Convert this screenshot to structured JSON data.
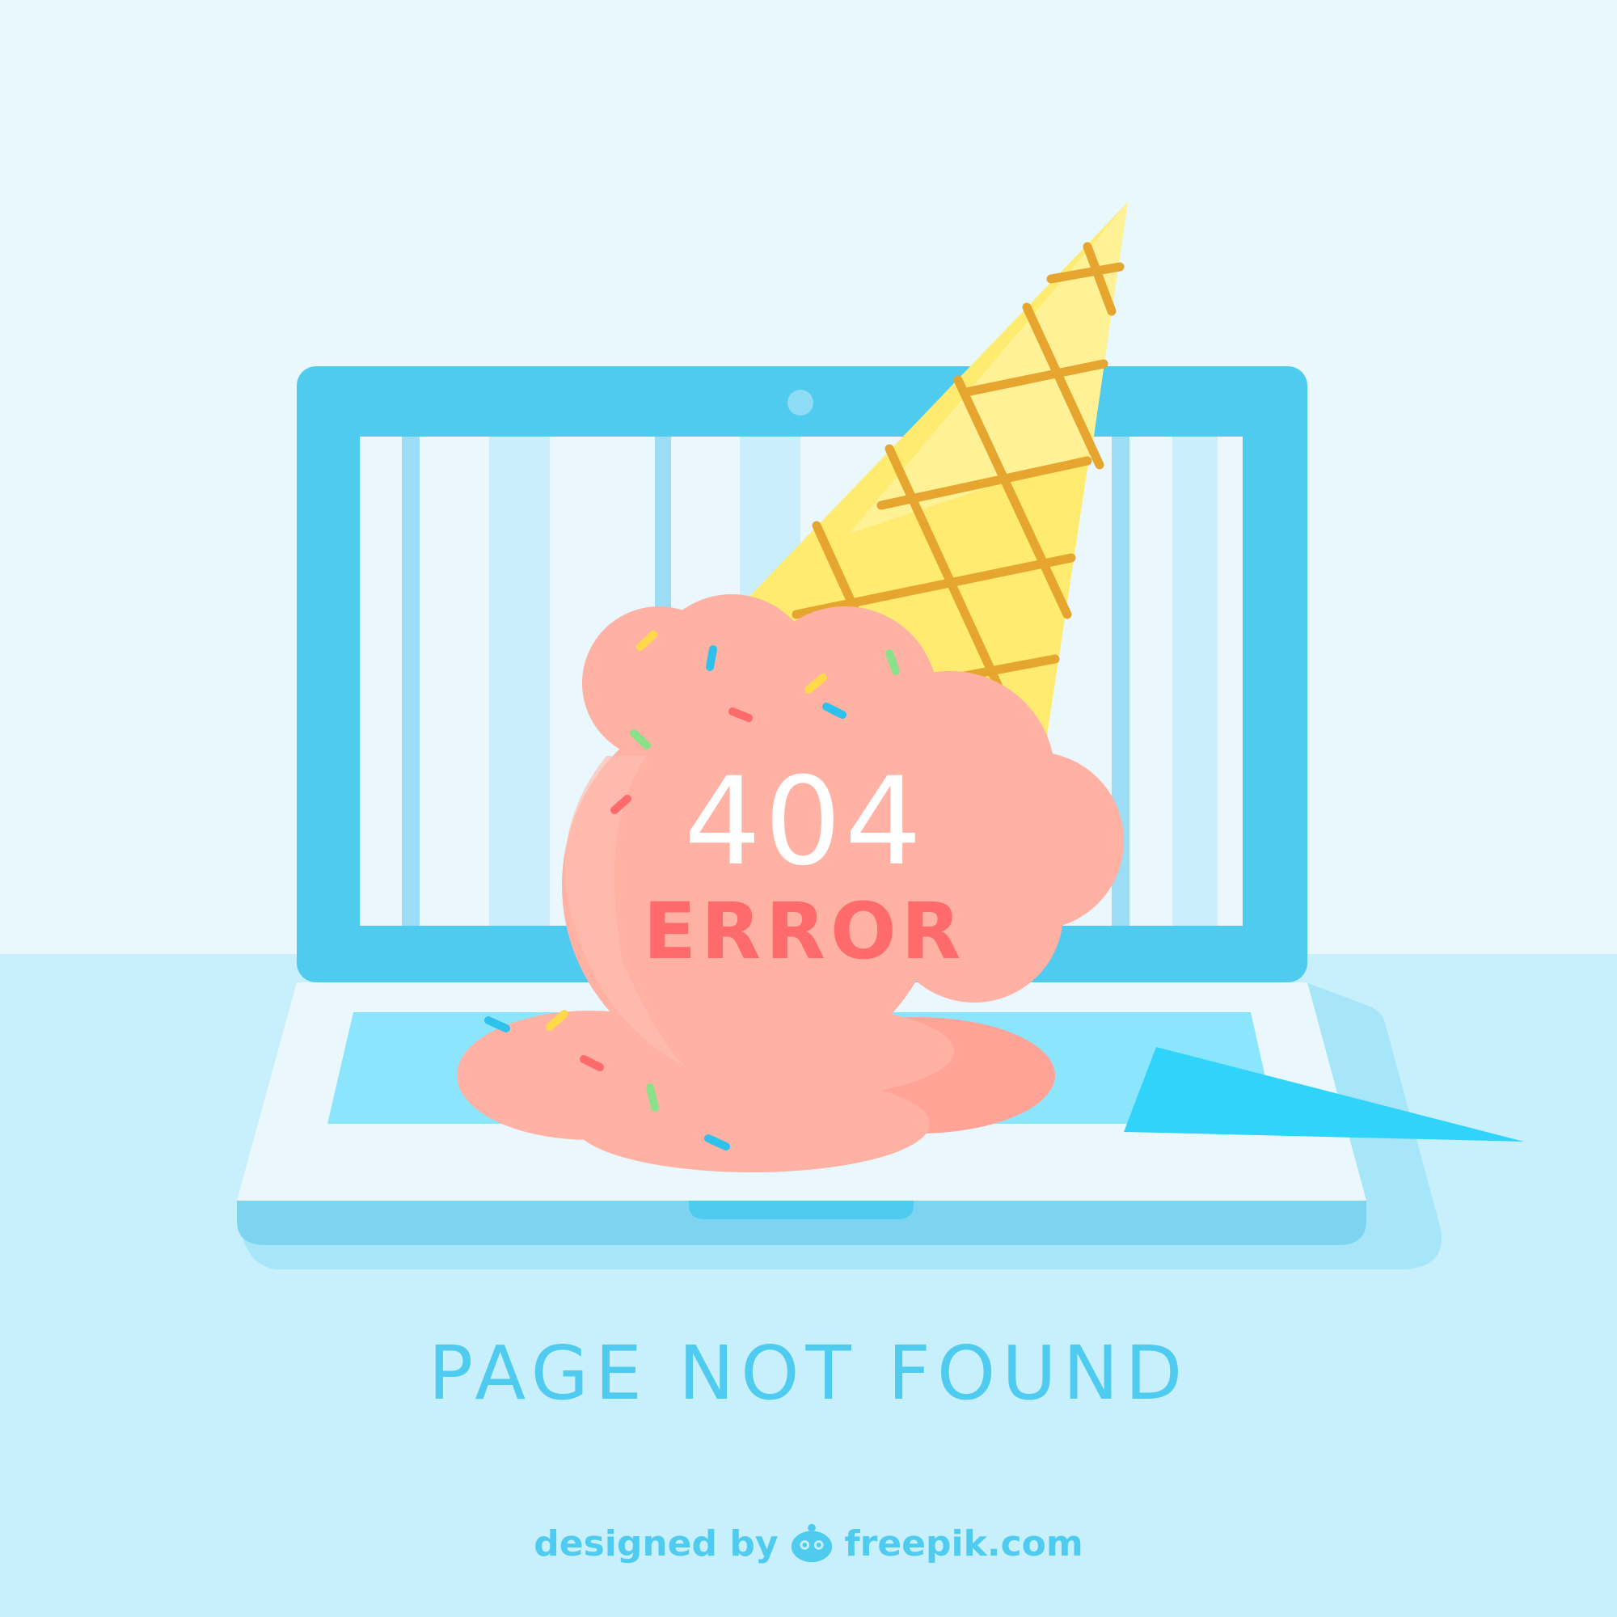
{
  "error_graphic": {
    "code": "404",
    "label": "ERROR"
  },
  "headline": "PAGE NOT FOUND",
  "credit": {
    "prefix": "designed by",
    "brand": "freepik.com",
    "logo_icon": "freepik-logo-icon"
  },
  "icons": {
    "laptop": "laptop-icon",
    "ice_cream": "melted-ice-cream-icon"
  },
  "colors": {
    "background_top": "#e8f8fd",
    "background_bottom": "#c8f0fc",
    "laptop_frame": "#4fcbf0",
    "scoop": "#ffb1a3",
    "cone": "#ffeb70",
    "code_text": "#ffffff",
    "error_text": "#ff6b6b",
    "headline": "#4fcbf0",
    "credit": "#4fcbf0"
  }
}
